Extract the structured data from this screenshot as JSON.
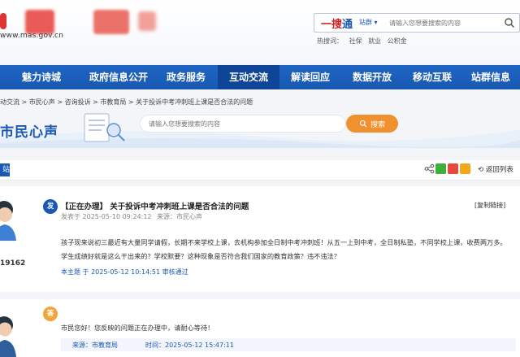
{
  "header": {
    "domain": "www.mas.gov.cn",
    "search": {
      "brand_main": "一搜",
      "brand_accent": "通",
      "site_select": "站群 ▾",
      "placeholder": "请输入您想要搜索的内容"
    },
    "hot_label": "热搜词：",
    "hot_words": [
      "社保",
      "就业",
      "公积金"
    ]
  },
  "nav": {
    "items": [
      "魅力诗城",
      "政府信息公开",
      "政务服务",
      "互动交流",
      "解读回应",
      "数据开放",
      "移动互联",
      "站群信息"
    ],
    "active_index": 3
  },
  "breadcrumb": "动交流 > 市民心声 > 咨询投诉 > 市教育局 > 关于投诉中考冲刺班上课是否合法的问题",
  "banner": {
    "title": "市民心声",
    "search_placeholder": "请输入您想要搜索的内容",
    "search_button": "搜索"
  },
  "toolbar": {
    "tag": "站",
    "back_label": "返回列表",
    "share_icons": [
      "share-icon",
      "wechat-icon",
      "weibo-icon",
      "qzone-icon"
    ]
  },
  "post": {
    "badge": "发",
    "title": "【正在办理】 关于投诉中考冲刺班上课是否合法的问题",
    "copy_link": "[复制链接]",
    "published": "发表于  2025-05-10 09:24:12",
    "source": "来源：市民心声",
    "user_id": "19162",
    "body_line1": "孩子现来说初三最近有大量同学请假，长期不来学校上课，去机构参加全日制中考冲刺班！从五一上到中考，全日制私塾，不同学校上课，收费两万多。",
    "body_line2": "学生成绩好就是这么干出来的？学校默要？这种现象是否符合我们国家的教育政策？违不违法？",
    "footer_prefix": "本主题  于  2025-05-12 10:14:51",
    "footer_status": "审核通过"
  },
  "reply": {
    "badge": "答",
    "text": "市民您好！您反映的问题正在办理中，请耐心等待！",
    "source": "来源：市教育局",
    "time": "时间：2025-05-12 15:47:11"
  },
  "colors": {
    "nav_blue": "#1858b0",
    "nav_active": "#0f4596",
    "accent_orange": "#f0902e",
    "brand_red": "#d41c1c"
  }
}
